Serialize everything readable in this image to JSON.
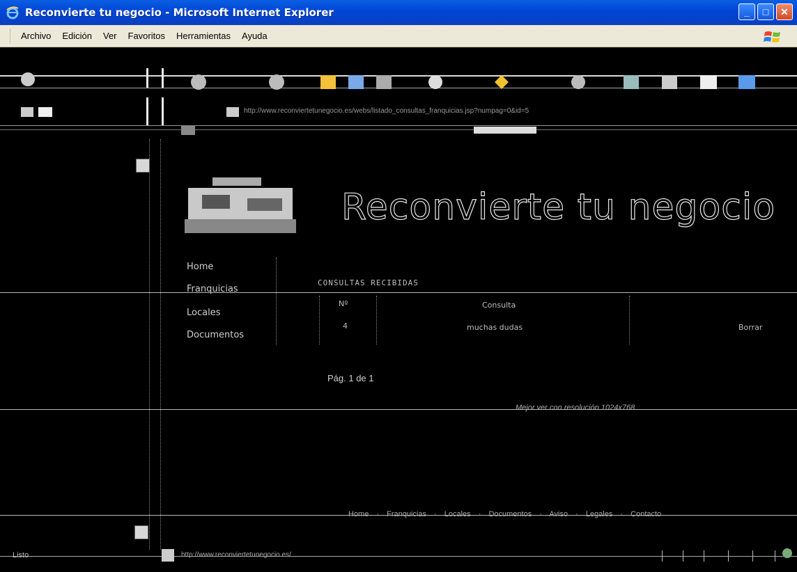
{
  "window": {
    "title": "Reconvierte tu negocio - Microsoft Internet Explorer",
    "minimize": "_",
    "maximize": "□",
    "close": "✕"
  },
  "menu": [
    "Archivo",
    "Edición",
    "Ver",
    "Favoritos",
    "Herramientas",
    "Ayuda"
  ],
  "icons": {
    "app": "ie-icon",
    "brand": "windows-flag-icon"
  },
  "page": {
    "header_title": "Reconvierte tu negocio",
    "nav": [
      "Home",
      "Franquicias",
      "Locales",
      "Documentos"
    ],
    "section_title": "CONSULTAS RECIBIDAS",
    "table": {
      "headers": [
        "Nº",
        "Consulta"
      ],
      "rows": [
        {
          "num": "4",
          "text": "muchas dudas",
          "status": "Borrar"
        }
      ]
    },
    "pager": "Pág. 1 de 1",
    "footer_link": "Mejor ver con resolución 1024x768",
    "footer_nav": "Home · Franquicias · Locales · Documentos · Aviso · Legales · Contacto"
  },
  "statusbar": {
    "state": "Listo",
    "url": "http://www.reconviertetunegocio.es/ "
  },
  "address": {
    "url": "http://www.reconviertetunegocio.es/webs/listado_consultas_franquicias.jsp?numpag=0&id=5"
  }
}
